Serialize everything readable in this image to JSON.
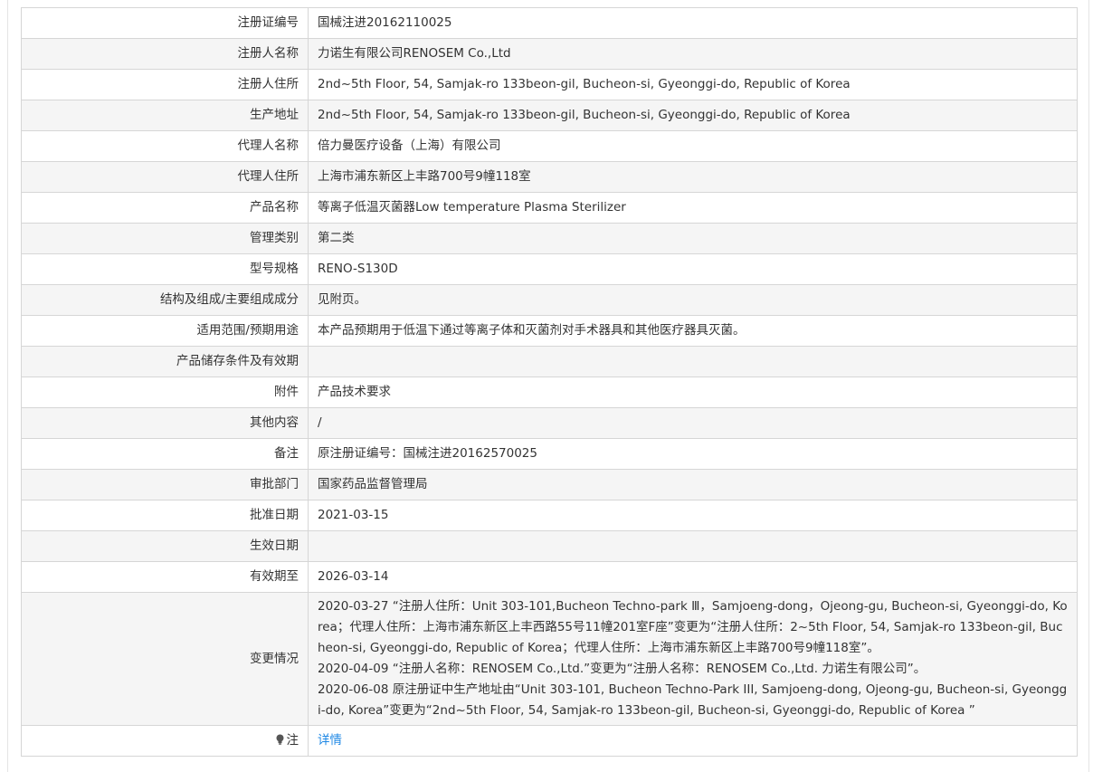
{
  "rows": [
    {
      "label": "注册证编号",
      "value": "国械注进20162110025"
    },
    {
      "label": "注册人名称",
      "value": "力诺生有限公司RENOSEM Co.,Ltd"
    },
    {
      "label": "注册人住所",
      "value": "2nd~5th Floor, 54, Samjak-ro 133beon-gil, Bucheon-si, Gyeonggi-do, Republic of Korea"
    },
    {
      "label": "生产地址",
      "value": "2nd~5th Floor, 54, Samjak-ro 133beon-gil, Bucheon-si, Gyeonggi-do, Republic of Korea"
    },
    {
      "label": "代理人名称",
      "value": "倍力曼医疗设备（上海）有限公司"
    },
    {
      "label": "代理人住所",
      "value": "上海市浦东新区上丰路700号9幢118室"
    },
    {
      "label": "产品名称",
      "value": "等离子低温灭菌器Low temperature Plasma Sterilizer"
    },
    {
      "label": "管理类别",
      "value": "第二类"
    },
    {
      "label": "型号规格",
      "value": "RENO-S130D"
    },
    {
      "label": "结构及组成/主要组成成分",
      "value": "见附页。"
    },
    {
      "label": "适用范围/预期用途",
      "value": "本产品预期用于低温下通过等离子体和灭菌剂对手术器具和其他医疗器具灭菌。"
    },
    {
      "label": "产品储存条件及有效期",
      "value": ""
    },
    {
      "label": "附件",
      "value": "产品技术要求"
    },
    {
      "label": "其他内容",
      "value": "/"
    },
    {
      "label": "备注",
      "value": "原注册证编号：国械注进20162570025"
    },
    {
      "label": "审批部门",
      "value": "国家药品监督管理局"
    },
    {
      "label": "批准日期",
      "value": "2021-03-15"
    },
    {
      "label": "生效日期",
      "value": ""
    },
    {
      "label": "有效期至",
      "value": "2026-03-14"
    }
  ],
  "changes": {
    "label": "变更情况",
    "lines": [
      "2020-03-27 “注册人住所：Unit 303-101,Bucheon Techno-park Ⅲ，Samjoeng-dong，Ojeong-gu, Bucheon-si, Gyeonggi-do, Korea；代理人住所：上海市浦东新区上丰西路55号11幢201室F座”变更为“注册人住所：2~5th Floor, 54, Samjak-ro 133beon-gil, Bucheon-si, Gyeonggi-do, Republic of Korea；代理人住所：上海市浦东新区上丰路700号9幢118室”。",
      "2020-04-09 “注册人名称：RENOSEM Co.,Ltd.”变更为“注册人名称：RENOSEM Co.,Ltd. 力诺生有限公司”。",
      "2020-06-08 原注册证中生产地址由“Unit 303-101, Bucheon Techno-Park III, Samjoeng-dong, Ojeong-gu, Bucheon-si, Gyeonggi-do, Korea”变更为“2nd~5th Floor, 54, Samjak-ro 133beon-gil, Bucheon-si, Gyeonggi-do, Republic of Korea ”"
    ]
  },
  "note": {
    "label": "注",
    "icon": "lightbulb-icon",
    "link_text": "详情",
    "link_color": "#1e88e5"
  }
}
